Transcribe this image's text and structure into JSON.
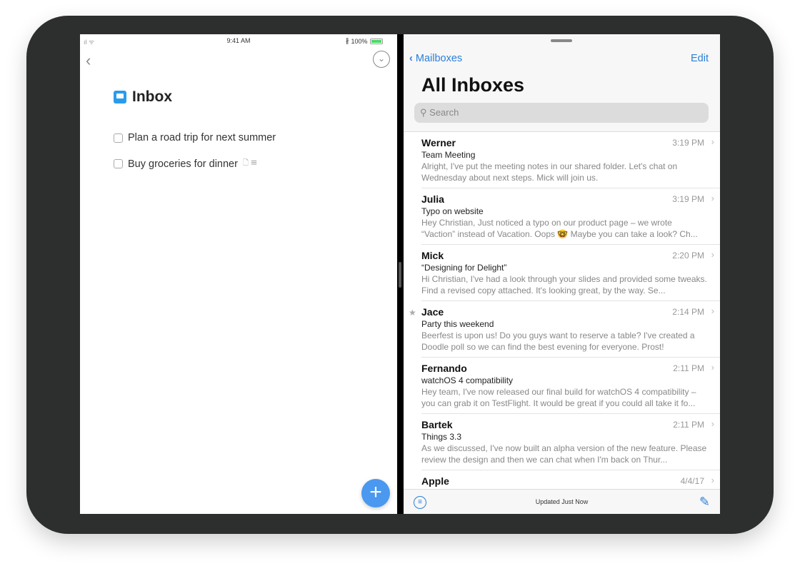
{
  "status": {
    "time": "9:41 AM",
    "battery": "100%"
  },
  "things": {
    "title": "Inbox",
    "tasks": [
      {
        "label": "Plan a road trip for next summer"
      },
      {
        "label": "Buy groceries for dinner",
        "meta": "🗋 ☰"
      }
    ]
  },
  "mail": {
    "back": "Mailboxes",
    "edit": "Edit",
    "title": "All Inboxes",
    "search_placeholder": "Search",
    "footer": "Updated Just Now",
    "messages": [
      {
        "sender": "Werner",
        "time": "3:19 PM",
        "subject": "Team Meeting",
        "preview": "Alright, I've put the meeting notes in our shared folder. Let's chat on Wednesday about next steps. Mick will join us."
      },
      {
        "sender": "Julia",
        "time": "3:19 PM",
        "subject": "Typo on website",
        "preview": "Hey Christian, Just noticed a typo on our product page – we wrote “Vaction” instead of Vacation. Oops 🤓 Maybe you can take a look? Ch..."
      },
      {
        "sender": "Mick",
        "time": "2:20 PM",
        "subject": "“Designing for Delight”",
        "preview": "Hi Christian, I've had a look through your slides and provided some tweaks. Find a revised copy attached. It's looking great, by the way. Se..."
      },
      {
        "sender": "Jace",
        "time": "2:14 PM",
        "subject": "Party this weekend",
        "preview": "Beerfest is upon us! Do you guys want to reserve a table? I've created a Doodle poll so we can find the best evening for everyone. Prost!",
        "starred": true
      },
      {
        "sender": "Fernando",
        "time": "2:11 PM",
        "subject": "watchOS 4 compatibility",
        "preview": "Hey team, I've now released our final build for watchOS 4 compatibility – you can grab it on TestFlight. It would be great if you could all take it fo..."
      },
      {
        "sender": "Bartek",
        "time": "2:11 PM",
        "subject": "Things 3.3",
        "preview": "As we discussed, I've now built an alpha version of the new feature. Please review the design and then we can chat when I'm back on Thur..."
      },
      {
        "sender": "Apple",
        "time": "4/4/17",
        "subject": "",
        "preview": ""
      }
    ]
  }
}
